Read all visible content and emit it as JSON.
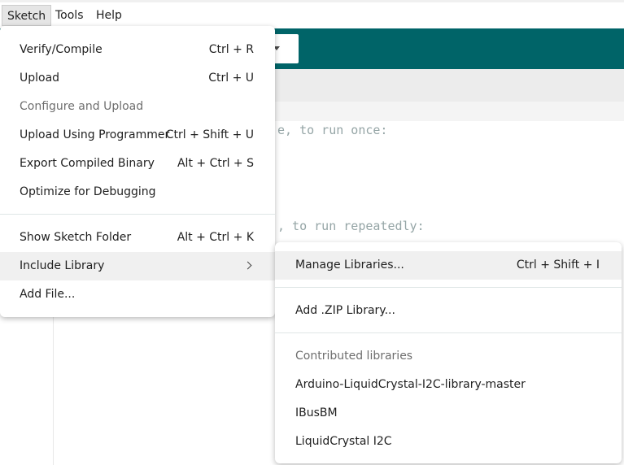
{
  "menubar": {
    "items": [
      "Sketch",
      "Tools",
      "Help"
    ]
  },
  "editor": {
    "lines": [
      "e, to run once:",
      ", to run repeatedly:"
    ]
  },
  "sketch_menu": {
    "items": [
      {
        "label": "Verify/Compile",
        "shortcut": "Ctrl + R"
      },
      {
        "label": "Upload",
        "shortcut": "Ctrl + U"
      },
      {
        "label": "Configure and Upload",
        "shortcut": "",
        "disabled": true
      },
      {
        "label": "Upload Using Programmer",
        "shortcut": "Ctrl + Shift + U"
      },
      {
        "label": "Export Compiled Binary",
        "shortcut": "Alt + Ctrl + S"
      },
      {
        "label": "Optimize for Debugging",
        "shortcut": ""
      },
      {
        "label": "Show Sketch Folder",
        "shortcut": "Alt + Ctrl + K"
      },
      {
        "label": "Include Library",
        "shortcut": "",
        "submenu": true
      },
      {
        "label": "Add File...",
        "shortcut": ""
      }
    ]
  },
  "library_menu": {
    "manage": {
      "label": "Manage Libraries...",
      "shortcut": "Ctrl + Shift + I"
    },
    "add_zip": {
      "label": "Add .ZIP Library..."
    },
    "contributed_header": "Contributed libraries",
    "libraries": [
      "Arduino-LiquidCrystal-I2C-library-master",
      "IBusBM",
      "LiquidCrystal I2C"
    ]
  },
  "colors": {
    "toolbar": "#006468",
    "highlight": "#f0f0f0",
    "comment_text": "#95a5a6"
  }
}
